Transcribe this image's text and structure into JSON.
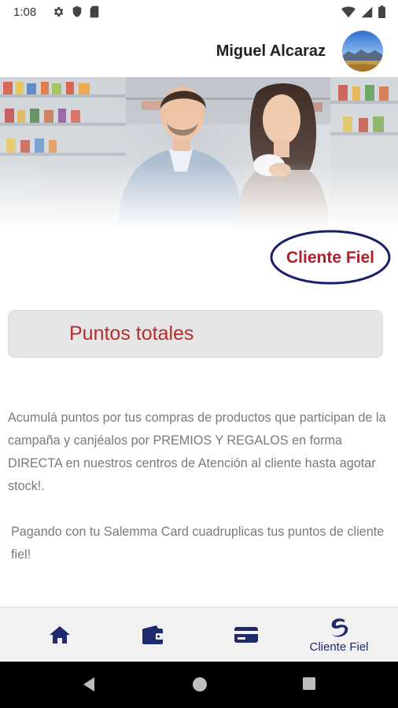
{
  "status_bar": {
    "time": "1:08",
    "left_icons": [
      "gear-icon",
      "shield-icon",
      "sim-card-icon"
    ],
    "right_icons": [
      "wifi-icon",
      "signal-icon",
      "battery-icon"
    ]
  },
  "header": {
    "user_name": "Miguel Alcaraz",
    "avatar_icon": "avatar-landscape-icon"
  },
  "banner": {
    "image": "shoppers-in-supermarket-photo"
  },
  "logo": {
    "text": "Cliente Fiel",
    "text_color": "#b0202a",
    "ring_color": "#1a1f6b"
  },
  "points": {
    "label": "Puntos totales",
    "label_color": "#b03030"
  },
  "description": {
    "paragraph_1": "Acumulá puntos por tus compras de productos que participan de la campaña y canjéalos por PREMIOS Y REGALOS en forma DIRECTA en nuestros centros de Atención al cliente hasta agotar stock!.",
    "paragraph_2": "Pagando con tu Salemma Card cuadruplicas tus puntos de cliente fiel!"
  },
  "bottom_nav": {
    "accent_color": "#1e2a6b",
    "items": [
      {
        "icon": "home-icon",
        "label": ""
      },
      {
        "icon": "wallet-icon",
        "label": ""
      },
      {
        "icon": "credit-card-icon",
        "label": ""
      },
      {
        "icon": "cliente-fiel-logo-icon",
        "label": "Cliente Fiel"
      }
    ]
  },
  "system_nav": {
    "buttons": [
      "back-icon",
      "home-circle-icon",
      "recents-icon"
    ]
  }
}
